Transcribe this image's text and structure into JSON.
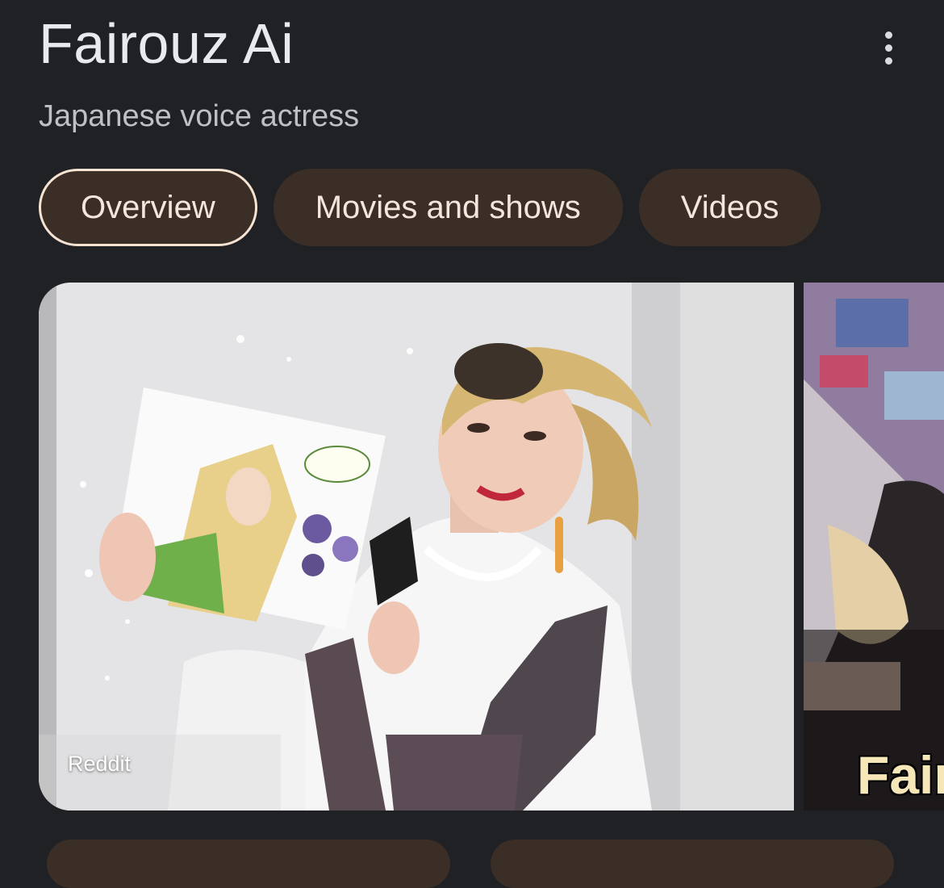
{
  "header": {
    "title": "Fairouz Ai",
    "subtitle": "Japanese voice actress"
  },
  "tabs": [
    {
      "label": "Overview",
      "active": true
    },
    {
      "label": "Movies and shows",
      "active": false
    },
    {
      "label": "Videos",
      "active": false
    }
  ],
  "images": [
    {
      "source": "Reddit"
    },
    {
      "caption": "Fair"
    }
  ],
  "colors": {
    "background": "#202124",
    "chip_bg": "#3a2e27",
    "chip_text": "#f4e6da"
  }
}
